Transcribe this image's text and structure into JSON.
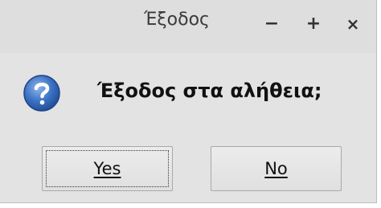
{
  "window": {
    "title": "Έξοδος",
    "minimize_glyph": "−",
    "maximize_glyph": "+",
    "close_glyph": "×"
  },
  "dialog": {
    "icon": "question-icon",
    "message": "Έξοδος στα αλήθεια;",
    "yes_label": "Yes",
    "no_label": "No",
    "default_button": "yes"
  },
  "colors": {
    "icon_blue": "#3a72c4",
    "window_bg": "#e3e3e3"
  }
}
